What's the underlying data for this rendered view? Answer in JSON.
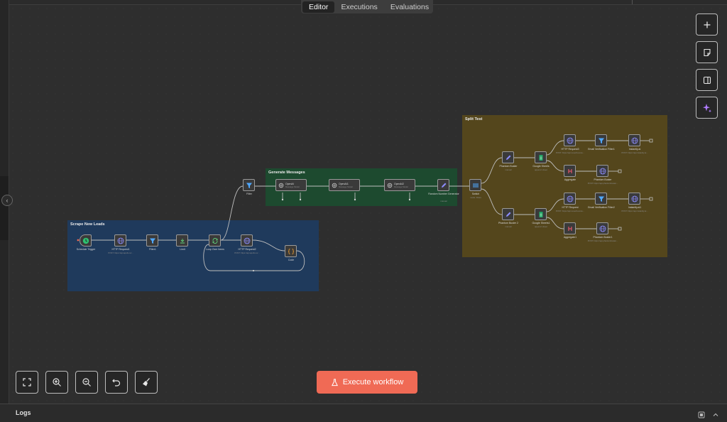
{
  "tabs": [
    "Editor",
    "Executions",
    "Evaluations"
  ],
  "groups": {
    "scrape": "Scrape New Leads",
    "generate": "Generate Messages",
    "split": "Split Test"
  },
  "nodes": {
    "schedule": {
      "label": "Schedule Trigger",
      "sub": ""
    },
    "http1": {
      "label": "HTTP Request1",
      "sub": "POST: https://api.apollo.io/..."
    },
    "filter1": {
      "label": "Filter1",
      "sub": ""
    },
    "limit": {
      "label": "Limit",
      "sub": ""
    },
    "loop": {
      "label": "Loop Over Items",
      "sub": ""
    },
    "http2": {
      "label": "HTTP Request2",
      "sub": "POST: https://api.apollo.io/..."
    },
    "code": {
      "label": "Code",
      "sub": ""
    },
    "filter": {
      "label": "Filter",
      "sub": ""
    },
    "openai1": {
      "label": "OpenAI",
      "sub": "Message Model"
    },
    "openai2": {
      "label": "OpenAI1",
      "sub": "Message Model"
    },
    "openai3": {
      "label": "OpenAI2",
      "sub": "Message Model"
    },
    "random": {
      "label": "Random Number Generator",
      "sub": "manual"
    },
    "switch": {
      "label": "Switch",
      "sub": "mode: Rules"
    },
    "phantom1": {
      "label": "Phantom Buster",
      "sub": "manual"
    },
    "sheets1": {
      "label": "Google Sheets",
      "sub": "append: sheet"
    },
    "httpR": {
      "label": "HTTP Request3",
      "sub": "POST: https://api.neverbounce..."
    },
    "emailF1": {
      "label": "Email Verification Filter1",
      "sub": ""
    },
    "instantly1": {
      "label": "Instantly.ai",
      "sub": "POST: https://api.instantly.ai..."
    },
    "agg1": {
      "label": "Aggregate",
      "sub": ""
    },
    "pbuster1": {
      "label": "Phantom Buster",
      "sub": "POST: https://api.phantombuster..."
    },
    "phantom2": {
      "label": "Phantom Buster 2",
      "sub": "manual"
    },
    "sheets2": {
      "label": "Google Sheets1",
      "sub": "append: sheet"
    },
    "httpR2": {
      "label": "HTTP Request",
      "sub": "POST: https://api.neverbounce..."
    },
    "emailF2": {
      "label": "Email Verification Filter2",
      "sub": ""
    },
    "instantly2": {
      "label": "Instantly.ai1",
      "sub": "POST: https://api.instantly.ai..."
    },
    "agg2": {
      "label": "Aggregate1",
      "sub": ""
    },
    "pbuster2": {
      "label": "Phantom Buster1",
      "sub": "POST: https://api.phantombuster..."
    }
  },
  "execute_label": "Execute workflow",
  "logs_label": "Logs",
  "colors": {
    "scrape_group": "#1f3a5c",
    "generate_group": "#1d4a2f",
    "split_group": "#54461c",
    "execute": "#f06a55",
    "node_icon": "#7d7dff"
  }
}
